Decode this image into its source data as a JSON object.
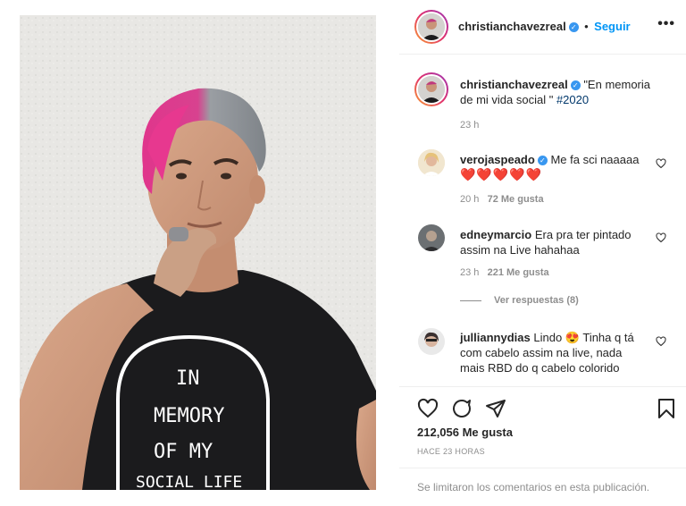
{
  "post": {
    "author": "christianchavezreal",
    "follow_label": "Seguir",
    "separator": "•",
    "more_label": "•••",
    "caption_author": "christianchavezreal",
    "caption_text": "\"En memoria de mi vida social \" ",
    "caption_hashtag": "#2020",
    "caption_time": "23 h",
    "shirt_text": [
      "IN",
      "MEMORY",
      "OF MY",
      "SOCIAL LIFE"
    ]
  },
  "comments": [
    {
      "user": "verojaspeado",
      "verified": true,
      "text": "Me fa sci naaaaa",
      "emoji": "❤️❤️❤️❤️❤️",
      "time": "20 h",
      "likes": "72 Me gusta"
    },
    {
      "user": "edneymarcio",
      "verified": false,
      "text": "Era pra ter pintado assim na Live hahahaa",
      "time": "23 h",
      "likes": "221 Me gusta"
    },
    {
      "user": "julliannydias",
      "verified": false,
      "text": "Lindo 😍 Tinha q tá com cabelo assim na live, nada mais RBD do q cabelo colorido"
    }
  ],
  "replies_label": "Ver respuestas (8)",
  "stats": {
    "likes": "212,056 Me gusta",
    "time": "HACE 23 HORAS"
  },
  "footer_text": "Se limitaron los comentarios en esta publicación.",
  "colors": {
    "accent": "#0095f6",
    "verified": "#3897f0",
    "heart": "#ed4956",
    "muted": "#8e8e8e"
  }
}
